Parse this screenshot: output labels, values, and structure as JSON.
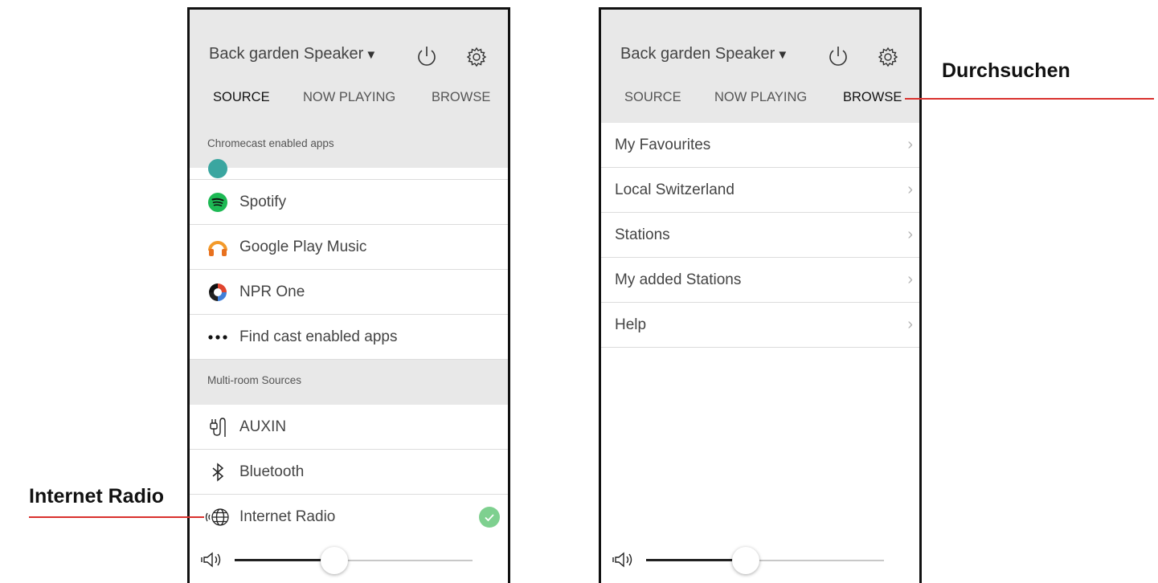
{
  "left_screen": {
    "device": {
      "name": "Back garden Speaker",
      "caret": "▼"
    },
    "tabs": [
      {
        "label": "SOURCE",
        "active": true
      },
      {
        "label": "NOW PLAYING",
        "active": false
      },
      {
        "label": "BROWSE",
        "active": false
      }
    ],
    "chromecast_section": "Chromecast enabled apps",
    "apps": [
      {
        "label": "Spotify",
        "icon": "spotify-icon"
      },
      {
        "label": "Google Play Music",
        "icon": "google-play-music-icon"
      },
      {
        "label": "NPR One",
        "icon": "npr-one-icon"
      },
      {
        "label": "Find cast enabled apps",
        "icon": "more-dots-icon"
      }
    ],
    "multiroom_section": "Multi-room Sources",
    "sources": [
      {
        "label": "AUXIN",
        "icon": "aux-cable-icon"
      },
      {
        "label": "Bluetooth",
        "icon": "bluetooth-icon"
      },
      {
        "label": "Internet Radio",
        "icon": "internet-radio-icon",
        "selected": true
      }
    ],
    "volume": {
      "level": 0.42
    }
  },
  "right_screen": {
    "device": {
      "name": "Back garden Speaker",
      "caret": "▼"
    },
    "tabs": [
      {
        "label": "SOURCE",
        "active": false
      },
      {
        "label": "NOW PLAYING",
        "active": false
      },
      {
        "label": "BROWSE",
        "active": true
      }
    ],
    "browse_items": [
      {
        "label": "My Favourites"
      },
      {
        "label": "Local Switzerland"
      },
      {
        "label": "Stations"
      },
      {
        "label": "My added Stations"
      },
      {
        "label": "Help"
      }
    ],
    "chevron": "›",
    "volume": {
      "level": 0.42
    }
  },
  "callouts": {
    "internet_radio": "Internet Radio",
    "browse": "Durchsuchen"
  },
  "colors": {
    "callout_line": "#d9312d",
    "header_bg": "#e8e8e8",
    "check_green": "#7ed08f",
    "spotify_green": "#1db954"
  }
}
